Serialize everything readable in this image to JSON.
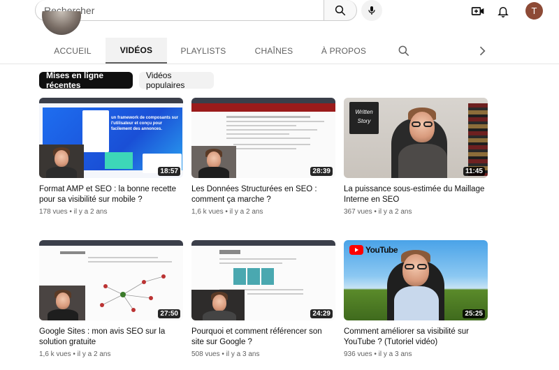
{
  "header": {
    "search_placeholder": "Rechercher",
    "avatar_initial": "T"
  },
  "tabs": [
    {
      "label": "ACCUEIL"
    },
    {
      "label": "VIDÉOS"
    },
    {
      "label": "PLAYLISTS"
    },
    {
      "label": "CHAÎNES"
    },
    {
      "label": "À PROPOS"
    }
  ],
  "chips": [
    {
      "label": "Mises en ligne récentes"
    },
    {
      "label": "Vidéos populaires"
    }
  ],
  "videos": [
    {
      "title": "Format AMP et SEO : la bonne recette pour sa visibilité sur mobile ?",
      "views": "178 vues",
      "age": "il y a 2 ans",
      "duration": "18:57"
    },
    {
      "title": "Les Données Structurées en SEO : comment ça marche ?",
      "views": "1,6 k vues",
      "age": "il y a 2 ans",
      "duration": "28:39"
    },
    {
      "title": "La puissance sous-estimée du Maillage Interne en SEO",
      "views": "367 vues",
      "age": "il y a 2 ans",
      "duration": "11:45"
    },
    {
      "title": "Google Sites : mon avis SEO sur la solution gratuite",
      "views": "1,6 k vues",
      "age": "il y a 2 ans",
      "duration": "27:50"
    },
    {
      "title": "Pourquoi et comment référencer son site sur Google ?",
      "views": "508 vues",
      "age": "il y a 3 ans",
      "duration": "24:29"
    },
    {
      "title": "Comment améliorer sa visibilité sur YouTube ? (Tutoriel vidéo)",
      "views": "936 vues",
      "age": "il y a 3 ans",
      "duration": "25:25"
    }
  ],
  "thumb_text": {
    "amp_banner": "un framework de composants sur l'utilisateur et conçu pour facilement des annonces.",
    "blackboard": "Written Story",
    "youtube_logo": "YouTube"
  },
  "meta_separator": "•",
  "colors": {
    "active_chip_bg": "#0f0f0f",
    "chip_bg": "#f2f2f2",
    "avatar_bg": "#8d4a36",
    "youtube_red": "#ff0000"
  },
  "icons": {
    "search": "search-icon",
    "mic": "microphone-icon",
    "create": "create-video-icon",
    "bell": "bell-icon",
    "tab_search": "search-icon",
    "tab_next": "chevron-right-icon"
  }
}
